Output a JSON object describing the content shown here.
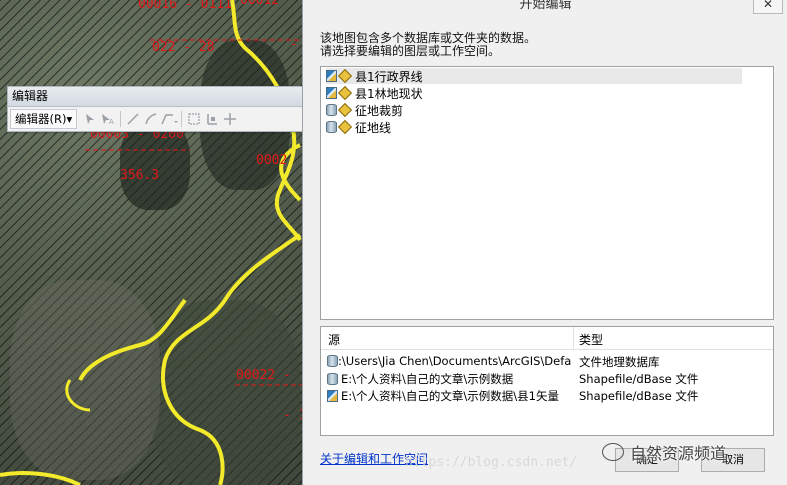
{
  "map": {
    "labels": [
      "00016 - 0111",
      "00012",
      "022 - 28",
      "- 7",
      "00003 - 0200",
      "0002",
      "356.3",
      "00022 -",
      "- 1"
    ]
  },
  "editor_toolbar": {
    "title": "编辑器",
    "menu_label": "编辑器(R)▾"
  },
  "dialog": {
    "title": "开始编辑",
    "close_glyph": "✕",
    "description_line1": "该地图包含多个数据库或文件夹的数据。",
    "description_line2": "请选择要编辑的图层或工作空间。",
    "layers": [
      {
        "label": "县1行政界线",
        "icon": "shapefile-icon"
      },
      {
        "label": "县1林地现状",
        "icon": "shapefile-icon"
      },
      {
        "label": "征地裁剪",
        "icon": "geodatabase-icon"
      },
      {
        "label": "征地线",
        "icon": "geodatabase-icon"
      }
    ],
    "sources": {
      "col_source": "源",
      "col_type": "类型",
      "rows": [
        {
          "path": "C:\\Users\\Jia Chen\\Documents\\ArcGIS\\Defa...",
          "type": "文件地理数据库",
          "icon": "geodatabase-icon"
        },
        {
          "path": "E:\\个人资料\\自己的文章\\示例数据",
          "type": "Shapefile/dBase 文件",
          "icon": "geodatabase-icon"
        },
        {
          "path": "E:\\个人资料\\自己的文章\\示例数据\\县1矢量",
          "type": "Shapefile/dBase 文件",
          "icon": "shapefile-icon"
        }
      ]
    },
    "help_link": "关于编辑和工作空间",
    "ok_label": "确定",
    "cancel_label": "取消"
  },
  "watermark": "https://blog.csdn.net/",
  "brand": "自然资源频道"
}
